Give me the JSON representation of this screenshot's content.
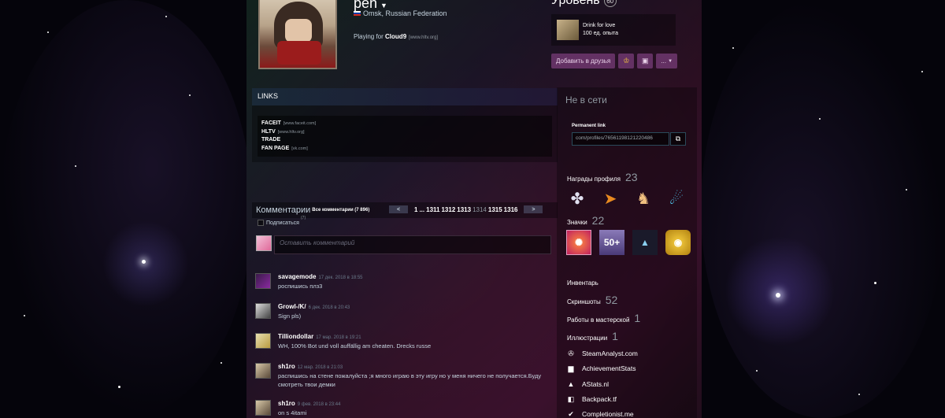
{
  "profile": {
    "persona_name": "pen",
    "location": "Omsk, Russian Federation",
    "playing_prefix": "Playing for",
    "team": "Cloud9",
    "team_site": "[www.hltv.org]"
  },
  "level": {
    "label": "Уровень",
    "value": "60"
  },
  "favorite_badge": {
    "name": "Drink for love",
    "xp": "100 ед. опыта"
  },
  "actions": {
    "add_friend": "Добавить в друзья",
    "more": "..."
  },
  "links": {
    "header": "LINKS",
    "items": [
      {
        "label": "FACEIT",
        "url": "[www.faceit.com]"
      },
      {
        "label": "HLTV",
        "url": "[www.hltv.org]"
      },
      {
        "label": "TRADE",
        "url": ""
      },
      {
        "label": "FAN PAGE",
        "url": "[vk.com]"
      }
    ]
  },
  "comments": {
    "title": "Комментарии",
    "all_label": "Все комментарии (7 896)",
    "all_suffix": "(7)",
    "pager": {
      "first": "1",
      "ellipsis": "...",
      "pages": [
        "1311",
        "1312",
        "1313"
      ],
      "current": "1314",
      "after": [
        "1315",
        "1316"
      ]
    },
    "subscribe": "Подписаться",
    "placeholder": "Оставить комментарий",
    "items": [
      {
        "author": "savagemode",
        "time": "17 дек. 2018 в 18:55",
        "text": "роспишись плз3"
      },
      {
        "author": "Growl-/K/",
        "time": "6 дек. 2018 в 20:43",
        "text": "Sign pls)"
      },
      {
        "author": "Tilliondollar",
        "time": "17 мар. 2018 в 19:21",
        "text": "WH, 100% Bot und voll auffällig am cheaten. Drecks russe"
      },
      {
        "author": "sh1ro",
        "time": "12 мар. 2018 в 21:03",
        "text": "распишись на стене пожалуйста ;я много играю в эту игру но у меня ничего не получается.Буду смотреть твои демки"
      },
      {
        "author": "sh1ro",
        "time": "9 фев. 2018 в 23:44",
        "text": "on s 4itami"
      }
    ]
  },
  "sidebar": {
    "status": "Не в сети",
    "permanent_link_label": "Permanent link",
    "permanent_link_value": "com/profiles/76561198121220486",
    "awards_label": "Награды профиля",
    "awards_count": "23",
    "badges_label": "Значки",
    "badges_count": "22",
    "badge_50_text": "50+",
    "inventory": "Инвентарь",
    "screenshots_label": "Скриншоты",
    "screenshots_count": "52",
    "workshop_label": "Работы в мастерской",
    "workshop_count": "1",
    "artwork_label": "Иллюстрации",
    "artwork_count": "1",
    "external": [
      {
        "label": "SteamAnalyst.com",
        "icon": "steamanalyst-icon"
      },
      {
        "label": "AchievementStats",
        "icon": "bar-chart-icon"
      },
      {
        "label": "AStats.nl",
        "icon": "astats-icon"
      },
      {
        "label": "Backpack.tf",
        "icon": "backpack-icon"
      },
      {
        "label": "Completionist.me",
        "icon": "completionist-icon"
      }
    ]
  },
  "colors": {
    "background": "#05040b",
    "profile_gradient_start": "#1f3b33",
    "profile_gradient_end": "#5a1a44",
    "button_purple": "#6e376e"
  }
}
